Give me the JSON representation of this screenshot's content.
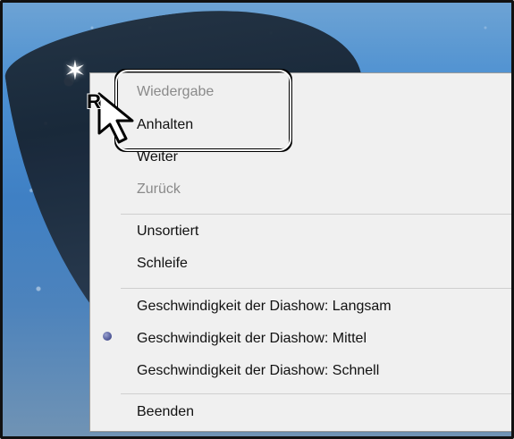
{
  "menu": {
    "items": [
      {
        "label": "Wiedergabe",
        "disabled": true
      },
      {
        "label": "Anhalten",
        "disabled": false
      },
      {
        "label": "Weiter",
        "disabled": false
      },
      {
        "label": "Zurück",
        "disabled": true
      },
      {
        "label": "Unsortiert",
        "disabled": false
      },
      {
        "label": "Schleife",
        "disabled": false
      },
      {
        "label": "Geschwindigkeit der Diashow: Langsam",
        "disabled": false
      },
      {
        "label": "Geschwindigkeit der Diashow: Mittel",
        "disabled": false,
        "selected": true
      },
      {
        "label": "Geschwindigkeit der Diashow: Schnell",
        "disabled": false
      },
      {
        "label": "Beenden",
        "disabled": false
      }
    ]
  },
  "cursor": {
    "letter": "R"
  },
  "colors": {
    "menu_background": "#f0f0f0",
    "disabled_text": "#8a8a8a",
    "highlight_box": "#000000",
    "selected_radio": "#5b63a1"
  },
  "icons": {
    "cursor": "mouse-pointer-icon",
    "selected_indicator": "radio-dot-icon"
  }
}
